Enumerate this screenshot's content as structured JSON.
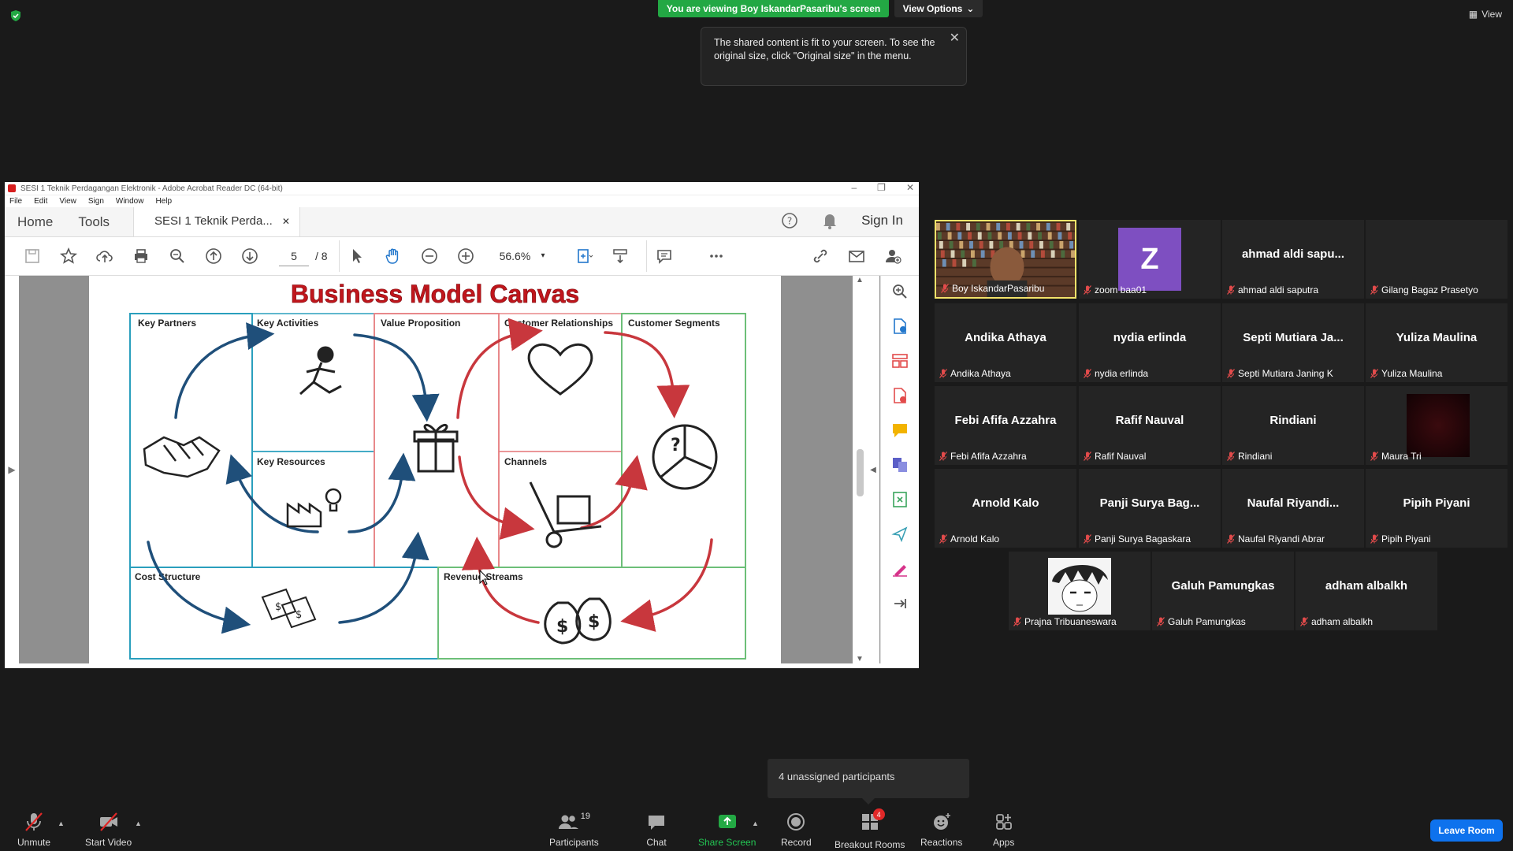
{
  "meeting": {
    "viewing_banner": "You are viewing Boy IskandarPasaribu's screen",
    "view_options_label": "View Options",
    "view_label": "View",
    "tooltip_text": "The shared content is fit to your screen. To see the original size, click \"Original size\" in the menu."
  },
  "acrobat": {
    "window_title": "SESI 1  Teknik Perdagangan Elektronik - Adobe Acrobat Reader DC (64-bit)",
    "menu": [
      "File",
      "Edit",
      "View",
      "Sign",
      "Window",
      "Help"
    ],
    "nav_home": "Home",
    "nav_tools": "Tools",
    "doc_tab": "SESI 1  Teknik Perda...",
    "sign_in": "Sign In",
    "page_current": "5",
    "page_total": "/  8",
    "zoom": "56.6%"
  },
  "canvas": {
    "title": "Business Model Canvas",
    "blocks": {
      "key_partners": "Key Partners",
      "key_activities": "Key Activities",
      "key_resources": "Key Resources",
      "value_proposition": "Value Proposition",
      "customer_relationships": "Customer Relationships",
      "channels": "Channels",
      "customer_segments": "Customer Segments",
      "cost_structure": "Cost Structure",
      "revenue_streams": "Revenue Streams"
    },
    "colors": {
      "title": "#c0161c",
      "blue": "#2a9fbd",
      "red": "#e8888a",
      "green": "#6cbf78",
      "arrow_blue": "#1f4f7a",
      "arrow_red": "#c8373d"
    }
  },
  "participants": [
    {
      "display": "",
      "label": "Boy IskandarPasaribu",
      "type": "camera",
      "active": true
    },
    {
      "display": "Z",
      "label": "zoom baa01",
      "type": "avatar"
    },
    {
      "display": "ahmad  aldi  sapu...",
      "label": "ahmad aldi saputra",
      "type": "name"
    },
    {
      "display": "",
      "label": "Gilang Bagaz Prasetyo",
      "type": "blank"
    },
    {
      "display": "Andika Athaya",
      "label": "Andika Athaya",
      "type": "name"
    },
    {
      "display": "nydia erlinda",
      "label": "nydia erlinda",
      "type": "name"
    },
    {
      "display": "Septi  Mutiara  Ja...",
      "label": "Septi Mutiara Janing K",
      "type": "name"
    },
    {
      "display": "Yuliza Maulina",
      "label": "Yuliza Maulina",
      "type": "name"
    },
    {
      "display": "Febi Afifa Azzahra",
      "label": "Febi Afifa Azzahra",
      "type": "name"
    },
    {
      "display": "Rafif Nauval",
      "label": "Rafif Nauval",
      "type": "name"
    },
    {
      "display": "Rindiani",
      "label": "Rindiani",
      "type": "name"
    },
    {
      "display": "",
      "label": "Maura Tri",
      "type": "dark"
    },
    {
      "display": "Arnold Kalo",
      "label": "Arnold Kalo",
      "type": "name"
    },
    {
      "display": "Panji  Surya  Bag...",
      "label": "Panji Surya Bagaskara",
      "type": "name"
    },
    {
      "display": "Naufal  Riyandi...",
      "label": "Naufal Riyandi Abrar",
      "type": "name"
    },
    {
      "display": "Pipih Piyani",
      "label": "Pipih Piyani",
      "type": "name"
    },
    {
      "display": "",
      "label": "Prajna Tribuaneswara",
      "type": "manga"
    },
    {
      "display": "Galuh Pamungkas",
      "label": "Galuh Pamungkas",
      "type": "name"
    },
    {
      "display": "adham albalkh",
      "label": "adham albalkh",
      "type": "name"
    }
  ],
  "bottom": {
    "unassigned": "4 unassigned participants",
    "unmute": "Unmute",
    "start_video": "Start Video",
    "participants": "Participants",
    "participants_count": "19",
    "chat": "Chat",
    "share_screen": "Share Screen",
    "record": "Record",
    "breakout_rooms": "Breakout Rooms",
    "breakout_badge": "4",
    "reactions": "Reactions",
    "apps": "Apps",
    "leave_room": "Leave Room"
  }
}
